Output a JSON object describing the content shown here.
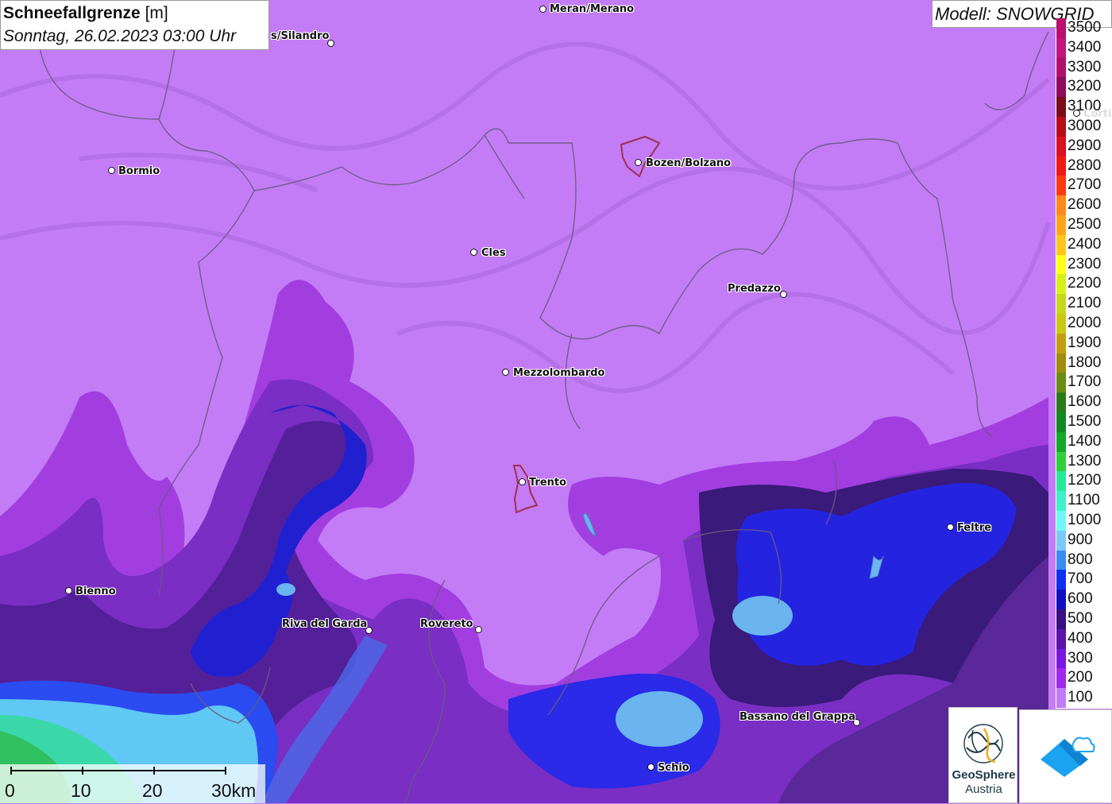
{
  "header": {
    "title_bold": "Schneefallgrenze",
    "title_unit": "[m]",
    "subtitle": "Sonntag, 26.02.2023 03:00 Uhr"
  },
  "model": {
    "label": "Modell: SNOWGRID"
  },
  "legend": {
    "items": [
      {
        "label": "3500",
        "color": "#b8106e"
      },
      {
        "label": "3400",
        "color": "#c0157a"
      },
      {
        "label": "3300",
        "color": "#b01067"
      },
      {
        "label": "3200",
        "color": "#8c0b5c"
      },
      {
        "label": "3100",
        "color": "#7c0c18"
      },
      {
        "label": "3000",
        "color": "#b50d19"
      },
      {
        "label": "2900",
        "color": "#d8121f"
      },
      {
        "label": "2800",
        "color": "#f01a14"
      },
      {
        "label": "2700",
        "color": "#ff3a10"
      },
      {
        "label": "2600",
        "color": "#ff8a1a"
      },
      {
        "label": "2500",
        "color": "#ffa61a"
      },
      {
        "label": "2400",
        "color": "#ffc61e"
      },
      {
        "label": "2300",
        "color": "#ffff1a"
      },
      {
        "label": "2200",
        "color": "#d8f01a"
      },
      {
        "label": "2100",
        "color": "#c6d81a"
      },
      {
        "label": "2000",
        "color": "#c8c814"
      },
      {
        "label": "1900",
        "color": "#c0a010"
      },
      {
        "label": "1800",
        "color": "#a08c10"
      },
      {
        "label": "1700",
        "color": "#6a8c14"
      },
      {
        "label": "1600",
        "color": "#2a7a1a"
      },
      {
        "label": "1500",
        "color": "#128a22"
      },
      {
        "label": "1400",
        "color": "#14a828"
      },
      {
        "label": "1300",
        "color": "#30d03a"
      },
      {
        "label": "1200",
        "color": "#28e89a"
      },
      {
        "label": "1100",
        "color": "#40f0c8"
      },
      {
        "label": "1000",
        "color": "#70f8f8"
      },
      {
        "label": "900",
        "color": "#7cc8f8"
      },
      {
        "label": "800",
        "color": "#3a8cf0"
      },
      {
        "label": "700",
        "color": "#1030f0"
      },
      {
        "label": "600",
        "color": "#1010c0"
      },
      {
        "label": "500",
        "color": "#3a1080"
      },
      {
        "label": "400",
        "color": "#5a14a8"
      },
      {
        "label": "300",
        "color": "#7a18e0"
      },
      {
        "label": "200",
        "color": "#a028e8"
      },
      {
        "label": "100",
        "color": "#c07cf5"
      }
    ]
  },
  "cities": [
    {
      "name": "Meran/Merano"
    },
    {
      "name": "s/Silandro"
    },
    {
      "name": "Bormio"
    },
    {
      "name": "Bozen/Bolzano"
    },
    {
      "name": "Cles"
    },
    {
      "name": "Predazzo"
    },
    {
      "name": "Mezzolombardo"
    },
    {
      "name": "Trento"
    },
    {
      "name": "Feltre"
    },
    {
      "name": "Bienno"
    },
    {
      "name": "Riva del Garda"
    },
    {
      "name": "Rovereto"
    },
    {
      "name": "Bassano del Grappa"
    },
    {
      "name": "Schio"
    },
    {
      "name": "Corti"
    }
  ],
  "scale": {
    "labels": [
      "0",
      "10",
      "20",
      "30km"
    ]
  },
  "logos": {
    "geosphere_line1": "GeoSphere",
    "geosphere_line2": "Austria"
  }
}
